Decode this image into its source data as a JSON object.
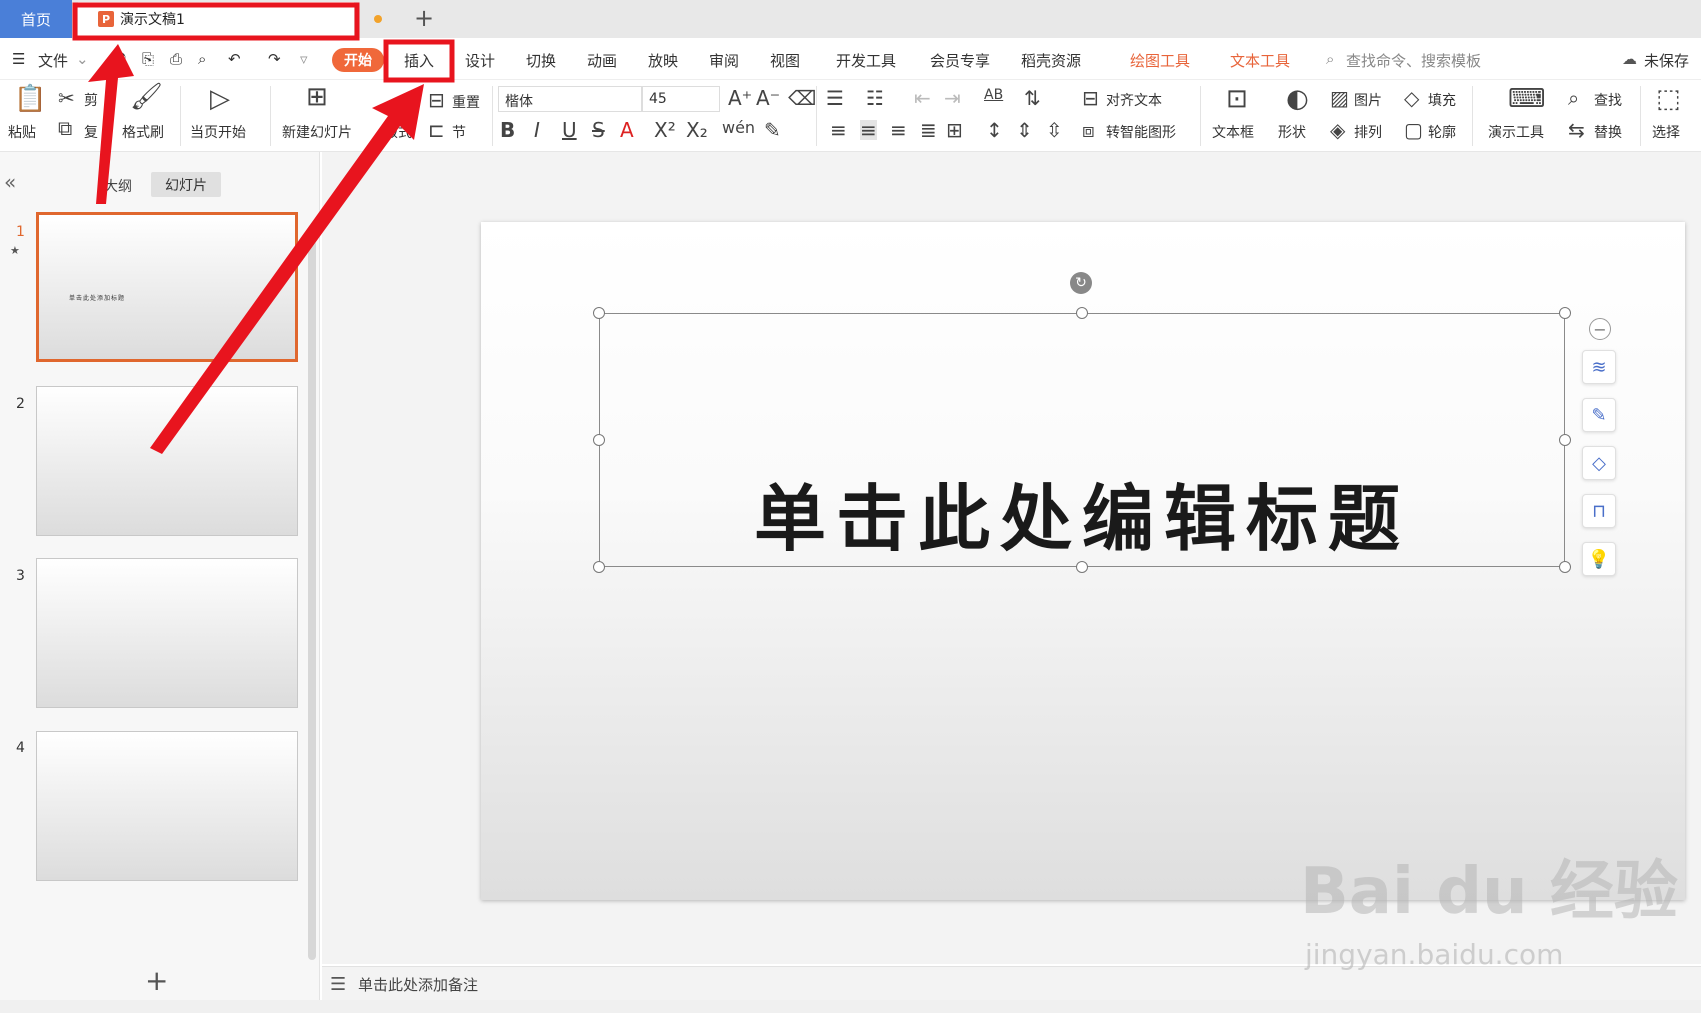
{
  "titlebar": {
    "home_tab": "首页",
    "doc_tab": "演示文稿1",
    "doc_icon": "P"
  },
  "menubar": {
    "file": "文件",
    "start": "开始",
    "items": [
      "插入",
      "设计",
      "切换",
      "动画",
      "放映",
      "审阅",
      "视图",
      "开发工具",
      "会员专享",
      "稻壳资源"
    ],
    "drawing_tools": "绘图工具",
    "text_tools": "文本工具",
    "search_placeholder": "查找命令、搜索模板",
    "unsaved": "未保存"
  },
  "toolbar": {
    "paste": "粘贴",
    "cut": "剪",
    "copy": "复",
    "format_painter": "格式刷",
    "from_current": "当页开始",
    "new_slide": "新建幻灯片",
    "layout": "版式",
    "reset": "重置",
    "section": "节",
    "font_name": "楷体",
    "font_size": "45",
    "align_text": "对齐文本",
    "smart_art": "转智能图形",
    "text_box": "文本框",
    "shape": "形状",
    "picture": "图片",
    "arrange": "排列",
    "fill": "填充",
    "outline": "轮廓",
    "presentation_tools": "演示工具",
    "find": "查找",
    "replace": "替换",
    "select": "选择"
  },
  "left_panel": {
    "tab_outline": "大纲",
    "tab_slides": "幻灯片",
    "slides": [
      "1",
      "2",
      "3",
      "4"
    ],
    "thumb1_text": "单击此处添加标题"
  },
  "slide": {
    "title_placeholder": "单击此处编辑标题"
  },
  "notes": {
    "placeholder": "单击此处添加备注"
  },
  "watermark": {
    "brand": "Bai du 经验",
    "url": "jingyan.baidu.com"
  },
  "colors": {
    "accent": "#e8643a",
    "home_tab": "#4a7fd8",
    "annotation_red": "#e8141e"
  }
}
